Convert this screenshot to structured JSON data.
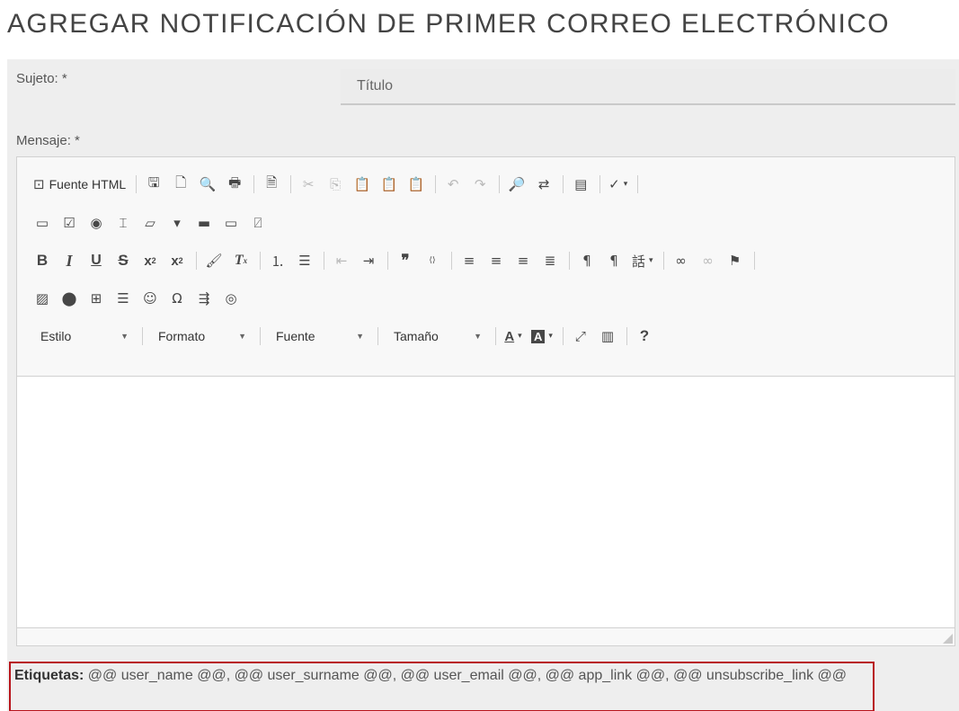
{
  "page": {
    "title": "AGREGAR NOTIFICACIÓN DE PRIMER CORREO ELECTRÓNICO"
  },
  "form": {
    "subject_label": "Sujeto: *",
    "subject_placeholder": "Título",
    "message_label": "Mensaje: *"
  },
  "editor": {
    "source_label": "Fuente HTML",
    "combos": {
      "style": "Estilo",
      "format": "Formato",
      "font": "Fuente",
      "size": "Tamaño"
    },
    "help_glyph": "?"
  },
  "tags": {
    "label": "Etiquetas:",
    "value": "@@ user_name @@, @@ user_surname @@, @@ user_email @@, @@ app_link @@, @@ unsubscribe_link @@"
  },
  "colors": {
    "tags_border": "#b8141b",
    "panel_bg": "#eeeeee",
    "toolbar_bg": "#f8f8f8"
  }
}
